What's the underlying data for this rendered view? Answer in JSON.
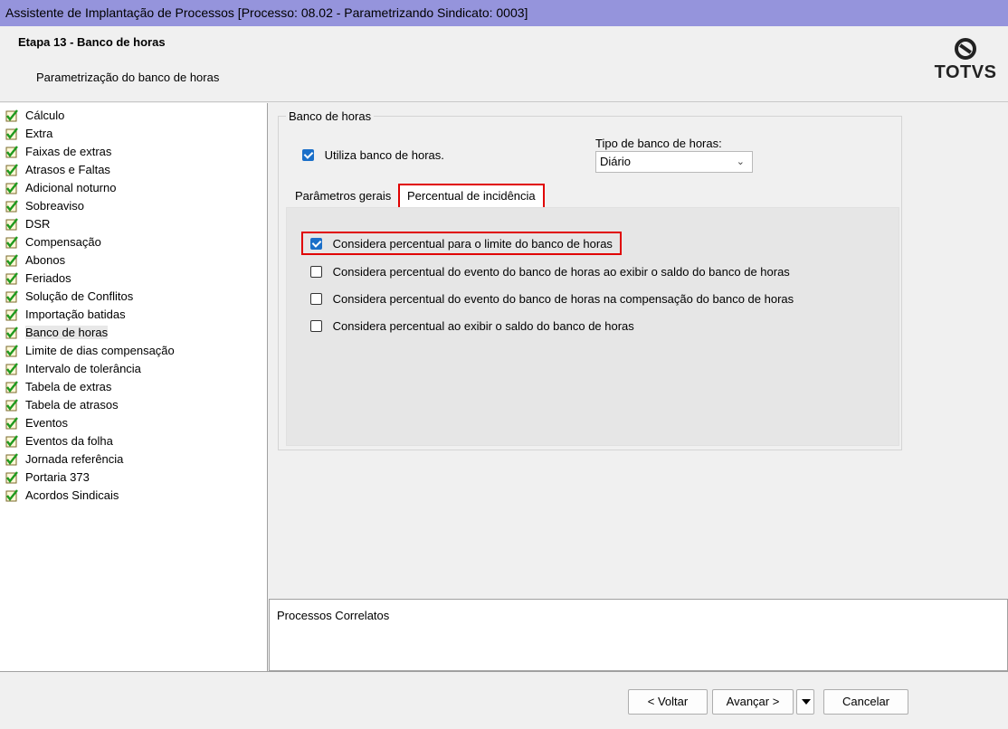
{
  "window": {
    "title": "Assistente de Implantação de Processos [Processo: 08.02 - Parametrizando Sindicato: 0003]"
  },
  "header": {
    "step_title": "Etapa 13 - Banco de horas",
    "step_subtitle": "Parametrização do banco de horas",
    "logo_text": "TOTVS"
  },
  "sidebar": {
    "items": [
      {
        "label": "Cálculo"
      },
      {
        "label": "Extra"
      },
      {
        "label": "Faixas de extras"
      },
      {
        "label": "Atrasos e Faltas"
      },
      {
        "label": "Adicional noturno"
      },
      {
        "label": "Sobreaviso"
      },
      {
        "label": "DSR"
      },
      {
        "label": "Compensação"
      },
      {
        "label": "Abonos"
      },
      {
        "label": "Feriados"
      },
      {
        "label": "Solução de Conflitos"
      },
      {
        "label": "Importação batidas"
      },
      {
        "label": "Banco de horas"
      },
      {
        "label": "Limite de dias compensação"
      },
      {
        "label": "Intervalo de tolerância"
      },
      {
        "label": "Tabela de extras"
      },
      {
        "label": "Tabela de atrasos"
      },
      {
        "label": "Eventos"
      },
      {
        "label": "Eventos da folha"
      },
      {
        "label": "Jornada referência"
      },
      {
        "label": "Portaria 373"
      },
      {
        "label": "Acordos Sindicais"
      }
    ],
    "selected": "Banco de horas"
  },
  "banco": {
    "group_label": "Banco de horas",
    "utiliza_label": "Utiliza banco de horas.",
    "utiliza_checked": true,
    "tipo_label": "Tipo de banco de horas:",
    "tipo_value": "Diário"
  },
  "tabs": {
    "gerais": "Parâmetros gerais",
    "percentual": "Percentual de incidência",
    "active": "percentual"
  },
  "options": [
    {
      "label": "Considera percentual para o limite do banco de horas",
      "checked": true
    },
    {
      "label": "Considera percentual do evento do banco de horas ao exibir o saldo do banco de horas",
      "checked": false
    },
    {
      "label": "Considera percentual do evento do banco de horas na compensação do banco de horas",
      "checked": false
    },
    {
      "label": "Considera percentual ao exibir o saldo do banco de horas",
      "checked": false
    }
  ],
  "correlatos": {
    "label": "Processos Correlatos"
  },
  "footer": {
    "voltar": "< Voltar",
    "avancar": "Avançar >",
    "cancelar": "Cancelar"
  },
  "colors": {
    "titlebar": "#9594dc",
    "highlight": "#e00000",
    "checkbox": "#1a6fc9"
  }
}
